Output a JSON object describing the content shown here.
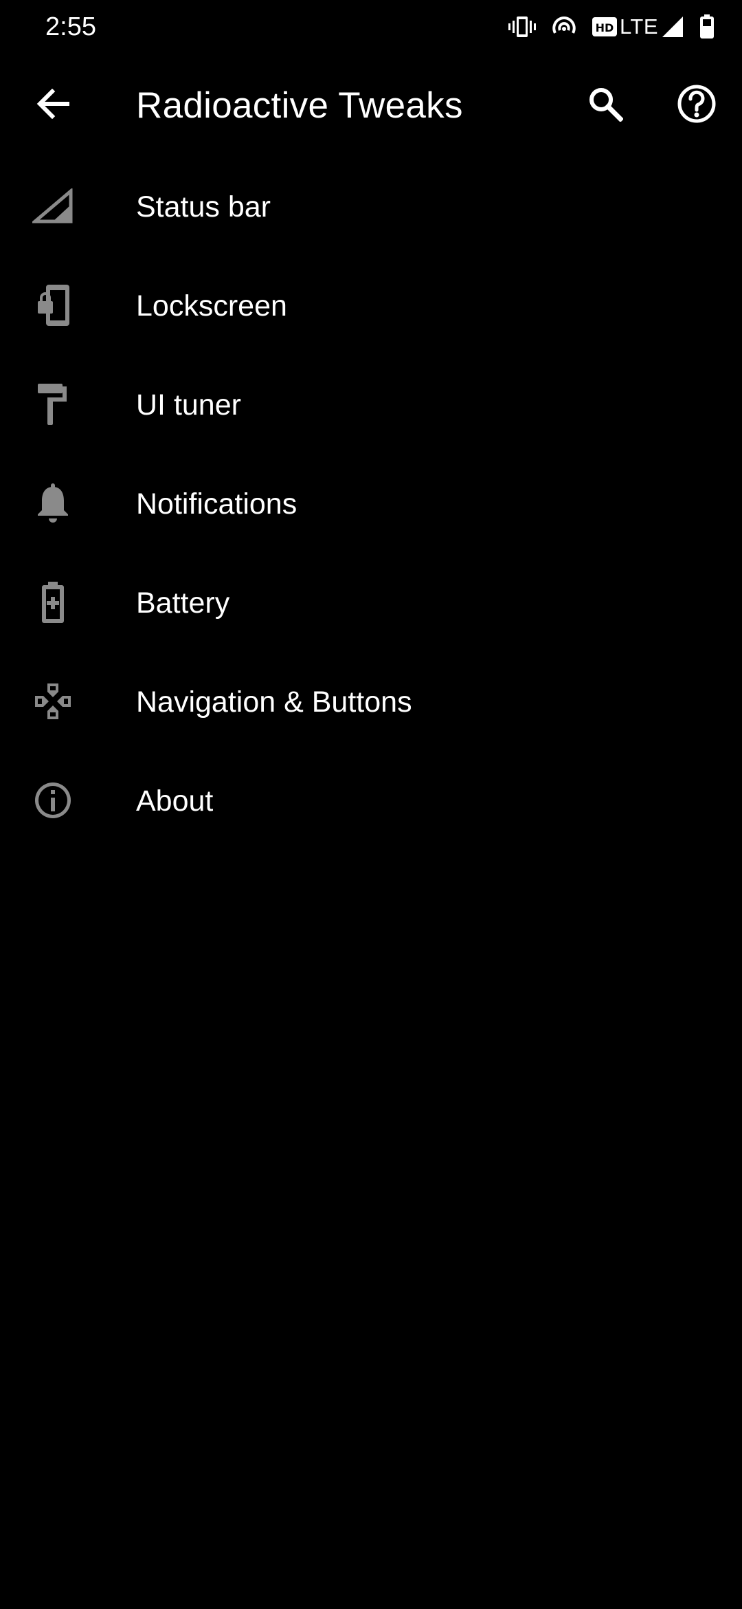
{
  "status_bar": {
    "time": "2:55",
    "network_label": "LTE",
    "icons": [
      "vibrate-icon",
      "hotspot-icon",
      "hd-icon",
      "signal-icon",
      "battery-icon"
    ]
  },
  "app_bar": {
    "title": "Radioactive Tweaks",
    "back_icon": "arrow-back-icon",
    "search_icon": "search-icon",
    "help_icon": "help-circle-icon"
  },
  "menu": {
    "items": [
      {
        "label": "Status bar",
        "icon": "cell-signal-icon"
      },
      {
        "label": "Lockscreen",
        "icon": "phone-lock-icon"
      },
      {
        "label": "UI tuner",
        "icon": "paint-roller-icon"
      },
      {
        "label": "Notifications",
        "icon": "bell-icon"
      },
      {
        "label": "Battery",
        "icon": "battery-charging-icon"
      },
      {
        "label": "Navigation & Buttons",
        "icon": "gamepad-icon"
      },
      {
        "label": "About",
        "icon": "info-icon"
      }
    ]
  },
  "colors": {
    "background": "#000000",
    "text": "#ffffff",
    "icon_gray": "#8a8a8a"
  }
}
